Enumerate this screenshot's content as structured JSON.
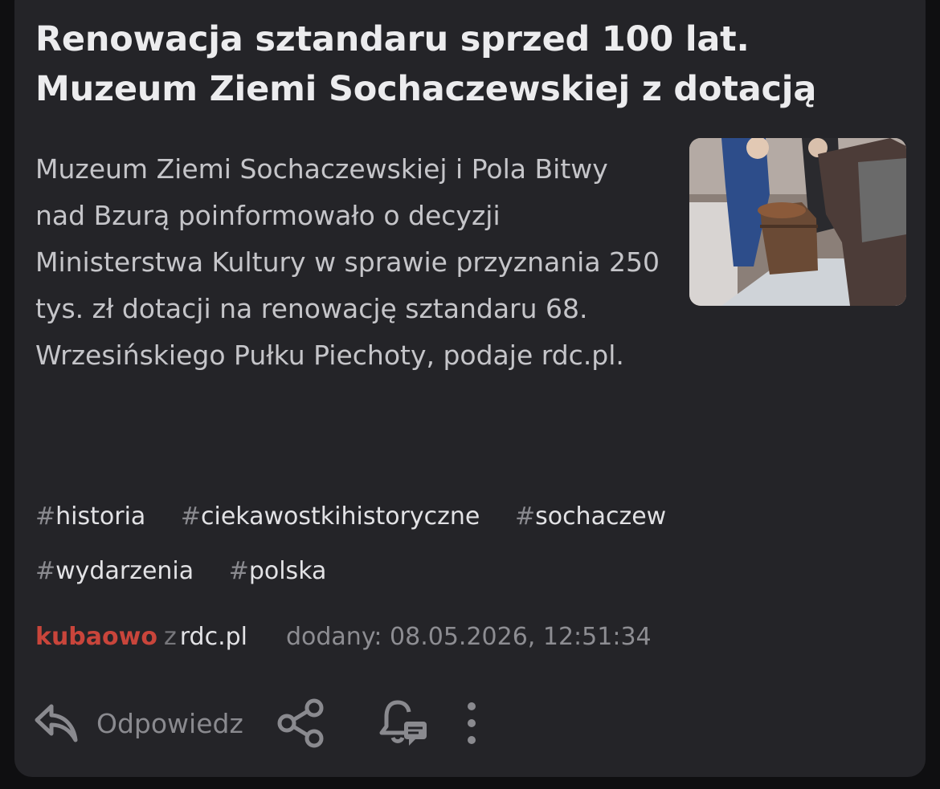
{
  "post": {
    "title": "Renowacja sztandaru sprzed 100 lat. Muzeum Ziemi Sochaczewskiej z dotacją",
    "summary": "Muzeum Ziemi Sochaczewskiej i Pola Bitwy nad Bzurą poinformowało o decyzji Ministerstwa Kultury w sprawie przyznania 250 tys. zł dotacji na renowację sztandaru 68. Wrzesińskiego Pułku Piechoty, podaje rdc.pl.",
    "tags": [
      {
        "hash": "#",
        "name": "historia"
      },
      {
        "hash": "#",
        "name": "ciekawostkihistoryczne"
      },
      {
        "hash": "#",
        "name": "sochaczew"
      },
      {
        "hash": "#",
        "name": "wydarzenia"
      },
      {
        "hash": "#",
        "name": "polska"
      }
    ],
    "author": "kubaowo",
    "from_word": "z",
    "source": "rdc.pl",
    "added": "dodany: 08.05.2026, 12:51:34"
  },
  "actions": {
    "reply_label": "Odpowiedz",
    "reply_icon": "reply-arrow-icon",
    "share_icon": "share-icon",
    "notify_icon": "bell-comment-icon",
    "more_icon": "more-vertical-icon"
  },
  "colors": {
    "background": "#0f0f11",
    "card": "#242428",
    "author": "#c9453b",
    "muted": "#8a8a8f"
  }
}
